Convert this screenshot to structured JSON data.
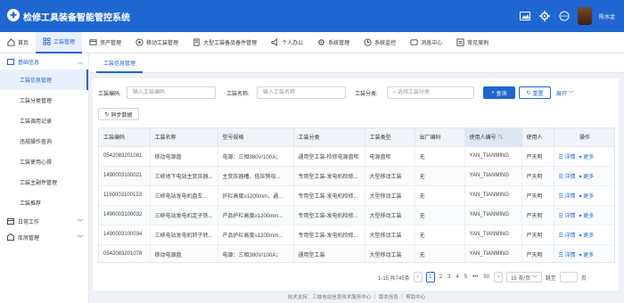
{
  "app": {
    "title": "检修工具装备智能管控系统",
    "logo_glyph": "✚"
  },
  "user": {
    "name": "陈水金"
  },
  "topbar": {
    "icons": [
      "image-icon",
      "gear-icon",
      "message-icon"
    ]
  },
  "nav": {
    "items": [
      {
        "label": "首页",
        "icon": "home-icon"
      },
      {
        "label": "工装管理",
        "icon": "grid-icon",
        "active": true
      },
      {
        "label": "资产管理",
        "icon": "asset-icon"
      },
      {
        "label": "移动工装管理",
        "icon": "mobile-icon"
      },
      {
        "label": "大型工装备品备件管理",
        "icon": "box-icon"
      },
      {
        "label": "个人办公",
        "icon": "bell-icon"
      },
      {
        "label": "系统管理",
        "icon": "gear-icon"
      },
      {
        "label": "系统监控",
        "icon": "monitor-icon"
      },
      {
        "label": "消息中心",
        "icon": "message-icon"
      },
      {
        "label": "常见案例",
        "icon": "case-icon"
      }
    ]
  },
  "sidebar": {
    "group1": "基础信息",
    "items": [
      "工装信息管理",
      "工装分类管理",
      "工装调用记录",
      "违规操作查询",
      "工装使用心得",
      "工装主副件管理",
      "工装推荐"
    ],
    "group2": "日常工作",
    "group3": "库房管理"
  },
  "tab": {
    "label": "工装信息管理"
  },
  "filters": {
    "code_label": "工装编码:",
    "code_placeholder": "输入工装编码",
    "name_label": "工装名称:",
    "name_placeholder": "输入工装名称",
    "cat_label": "工装分类:",
    "cat_placeholder": "选择工装分类",
    "search_btn": "查询",
    "reset_btn": "重置",
    "expand": "展开",
    "sync_btn": "同步数据"
  },
  "table": {
    "headers": [
      "工装编码",
      "工装名称",
      "型号规格",
      "工装分类",
      "工装类型",
      "出厂编码",
      "使用人编号",
      "使用人",
      "操作"
    ],
    "rows": [
      [
        "0542083201081",
        "移动电源盘",
        "电源：三相380V/100A；",
        "通用型工装-检修电源盘柜",
        "电源盘柜",
        "无",
        "YAN_TIANMING",
        "严天明",
        ""
      ],
      [
        "1490003100021",
        "三峡地下电站主变压器...",
        "主变压器槽、低压侧母...",
        "专用型工装-发电机检修...",
        "大型移动工装",
        "无",
        "YAN_TIANMING",
        "严天明",
        ""
      ],
      [
        "1190003100133",
        "三峡电站发电机盘车...",
        "护栏高度≥1200mm，通...",
        "专用型工装-发电机检修...",
        "大型移动工装",
        "无",
        "YAN_TIANMING",
        "严天明",
        ""
      ],
      [
        "1490003100032",
        "三峡电站发电机定子铁...",
        "产品护栏高度≥1200mm...",
        "专用型工装-发电机检修...",
        "大型移动工装",
        "无",
        "YAN_TIANMING",
        "严天明",
        ""
      ],
      [
        "1490003100034",
        "三峡电站发电机转子转...",
        "产品护栏高度≥1200mm...",
        "专用型工装-发电机检修...",
        "大型移动工装",
        "无",
        "YAN_TIANMING",
        "严天明",
        ""
      ],
      [
        "0542083201078",
        "移动电源盘",
        "电源：三相380V/100A；",
        "通用型工装",
        "大型移动工装",
        "无",
        "YAN_TIANMING",
        "严天明",
        ""
      ]
    ],
    "op_detail": "☰ 详情",
    "op_more": "▾ 更多"
  },
  "pager": {
    "total": "1-15 共745条",
    "prev": "‹",
    "pages": [
      "1",
      "2",
      "3",
      "4",
      "5",
      "•••",
      "50"
    ],
    "next": "›",
    "page_size": "15 条/页",
    "jump_label": "跳至",
    "jump_suffix": "页"
  },
  "footer": {
    "text": "技术支持：三峡电站信息技术服务中心 ｜ 版本信息 ｜ 帮助中心"
  }
}
